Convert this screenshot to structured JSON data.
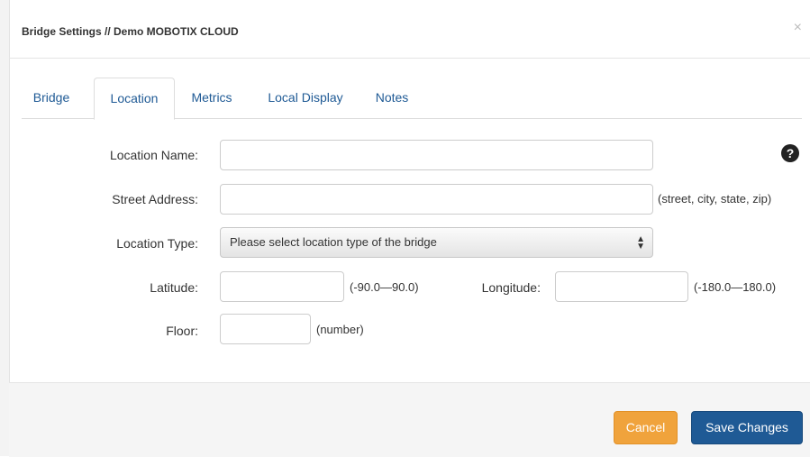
{
  "header": {
    "title": "Bridge Settings // Demo MOBOTIX CLOUD",
    "close_label": "×"
  },
  "tabs": [
    {
      "label": "Bridge"
    },
    {
      "label": "Location"
    },
    {
      "label": "Metrics"
    },
    {
      "label": "Local Display"
    },
    {
      "label": "Notes"
    }
  ],
  "active_tab": "Location",
  "form": {
    "location_name": {
      "label": "Location Name:",
      "value": ""
    },
    "street_address": {
      "label": "Street Address:",
      "value": "",
      "hint": "(street, city, state, zip)"
    },
    "location_type": {
      "label": "Location Type:",
      "selected": "Please select location type of the bridge"
    },
    "latitude": {
      "label": "Latitude:",
      "value": "",
      "hint": "(-90.0—90.0)"
    },
    "longitude": {
      "label": "Longitude:",
      "value": "",
      "hint": "(-180.0—180.0)"
    },
    "floor": {
      "label": "Floor:",
      "value": "",
      "hint": "(number)"
    }
  },
  "help_icon": {
    "glyph": "?"
  },
  "footer": {
    "cancel_label": "Cancel",
    "save_label": "Save Changes"
  },
  "colors": {
    "primary": "#1f5a95",
    "cancel": "#f0a33c"
  }
}
